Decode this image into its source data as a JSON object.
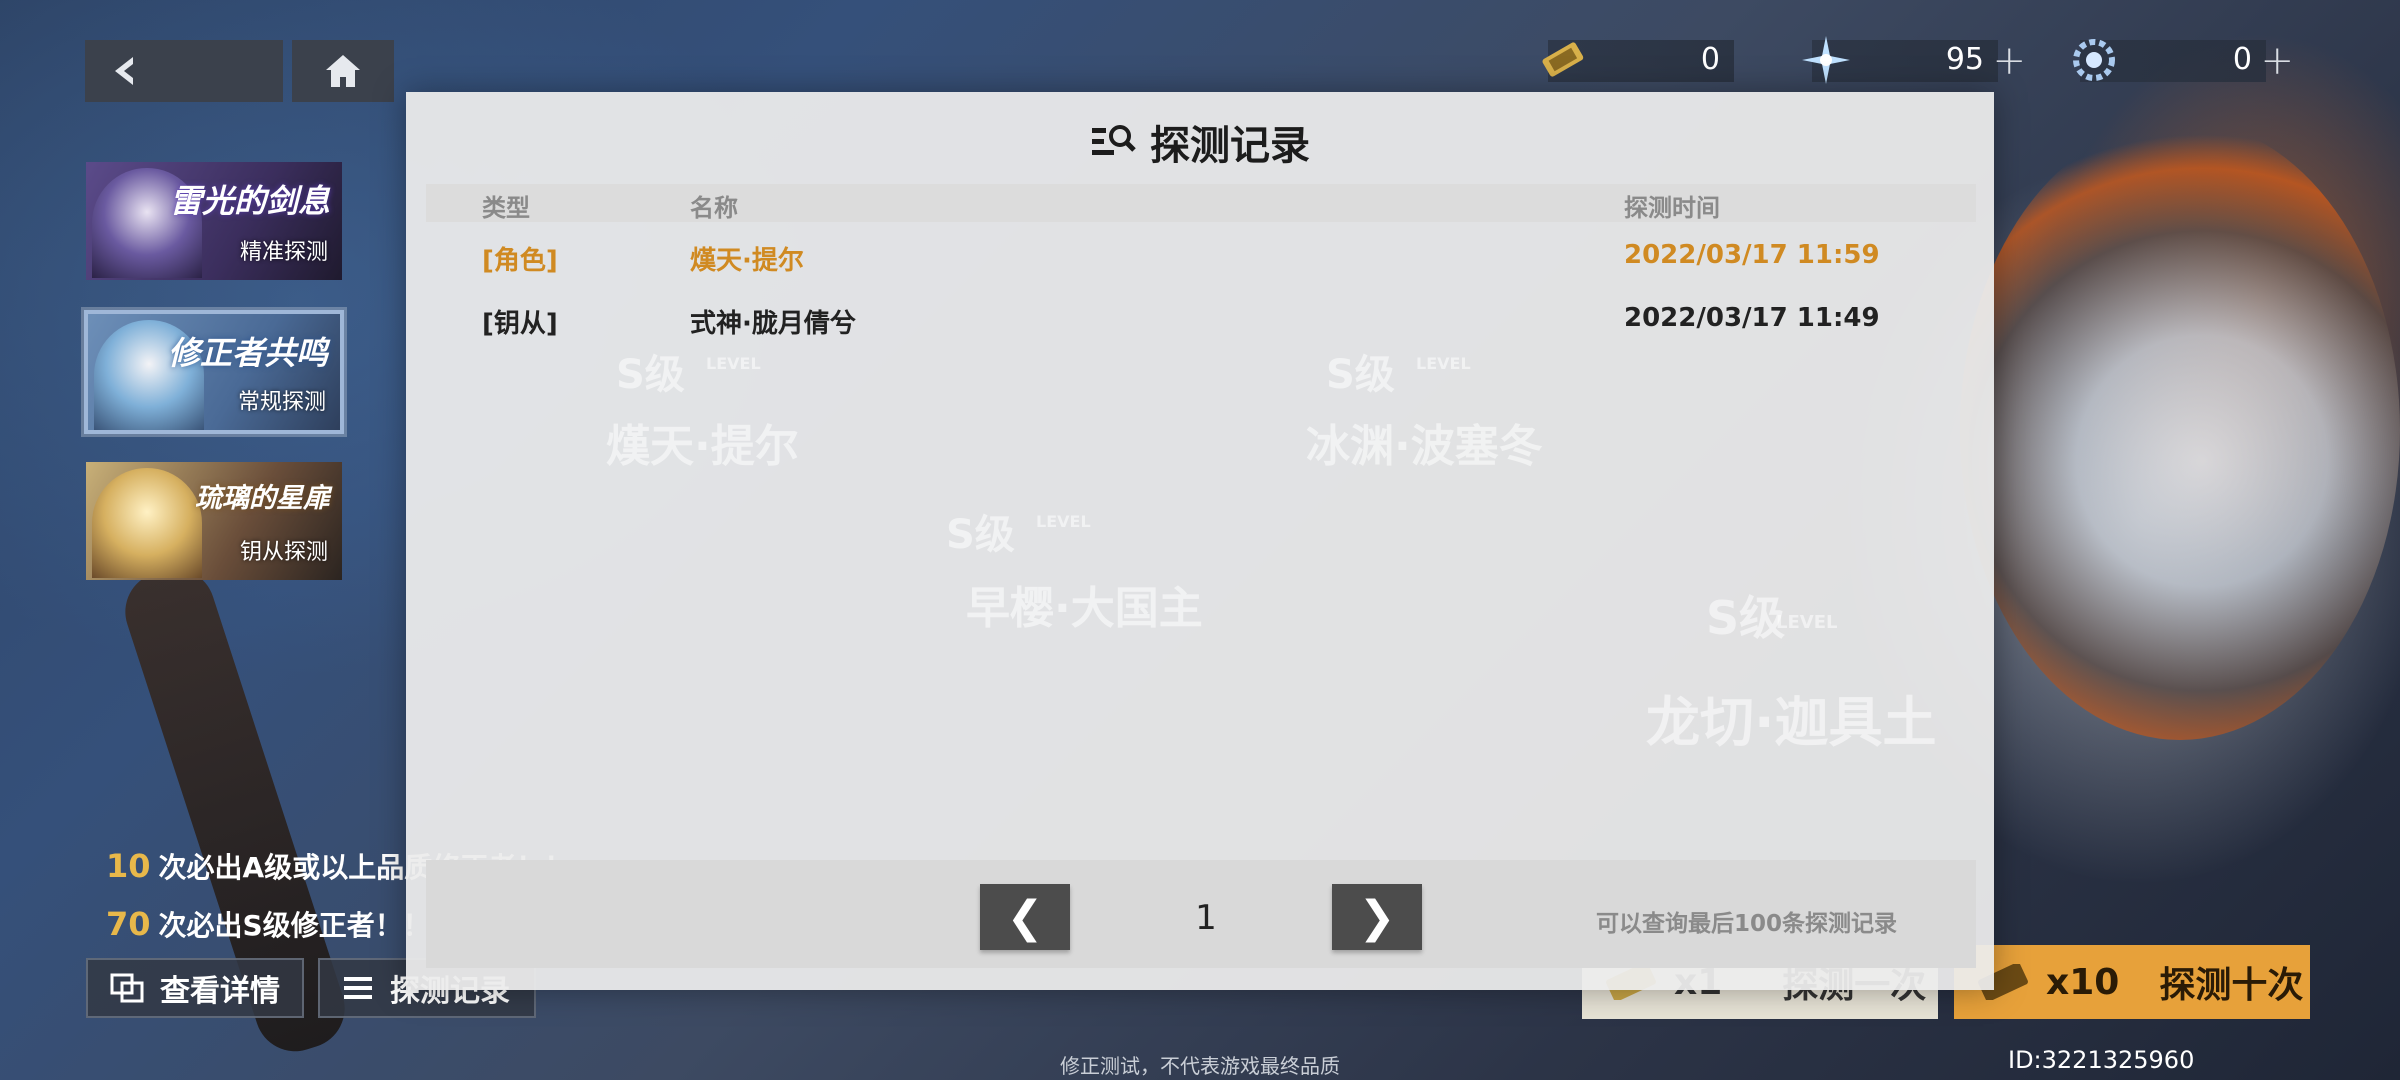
{
  "currencies": [
    {
      "icon": "gold-ticket-icon",
      "value": "0"
    },
    {
      "icon": "blue-crystal-icon",
      "value": "95"
    },
    {
      "icon": "blue-gear-crystal-icon",
      "value": "0"
    }
  ],
  "banners": [
    {
      "title": "雷光的剑息",
      "sub": "精准探测"
    },
    {
      "title": "修正者共鸣",
      "sub": "常规探测"
    },
    {
      "title": "琉璃的星扉",
      "sub": "钥从探测"
    }
  ],
  "guarantees": [
    {
      "num": "10",
      "text": "次必出A级或以上品质修正者！！"
    },
    {
      "num": "70",
      "text": "次必出S级修正者！！"
    }
  ],
  "bottom_buttons": {
    "details": "查看详情",
    "records": "探测记录"
  },
  "draw_buttons": {
    "one_count": "x1",
    "one_label": "探测一次",
    "ten_count": "x10",
    "ten_label": "探测十次"
  },
  "footnote": "修正测试，不代表游戏最终品质",
  "user_id": "ID:3221325960",
  "background_watermarks": [
    "S级",
    "S级",
    "S级",
    "S级",
    "LEVEL",
    "LEVEL",
    "LEVEL",
    "LEVEL",
    "熯天·提尔",
    "冰渊·波塞冬",
    "早樱·大国主",
    "龙切·迦具土"
  ],
  "modal": {
    "title": "探测记录",
    "columns": {
      "type": "类型",
      "name": "名称",
      "time": "探测时间"
    },
    "rows": [
      {
        "type": "[角色]",
        "name": "熯天·提尔",
        "time": "2022/03/17 11:59",
        "color": "#d08a22"
      },
      {
        "type": "[钥从]",
        "name": "式神·胧月倩兮",
        "time": "2022/03/17 11:49",
        "color": "#222222"
      }
    ],
    "pager": {
      "prev": "❮",
      "next": "❯",
      "page": "1",
      "note": "可以查询最后100条探测记录"
    }
  }
}
